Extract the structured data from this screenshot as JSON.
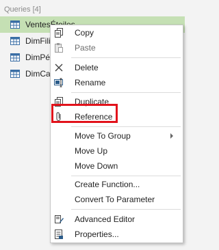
{
  "queries_pane": {
    "header": "Queries [4]",
    "items": [
      {
        "label": "VentesÉtoiles",
        "selected": true
      },
      {
        "label": "DimFili"
      },
      {
        "label": "DimPé"
      },
      {
        "label": "DimCa"
      }
    ]
  },
  "context_menu": {
    "copy": "Copy",
    "paste": "Paste",
    "delete": "Delete",
    "rename": "Rename",
    "duplicate": "Duplicate",
    "reference": "Reference",
    "move_to_group": "Move To Group",
    "move_up": "Move Up",
    "move_down": "Move Down",
    "create_function": "Create Function...",
    "convert_to_parameter": "Convert To Parameter",
    "advanced_editor": "Advanced Editor",
    "properties": "Properties..."
  },
  "colors": {
    "selected_row": "#c5e0b4",
    "highlight_border": "#e2121b",
    "table_icon": "#3a6ea5"
  }
}
